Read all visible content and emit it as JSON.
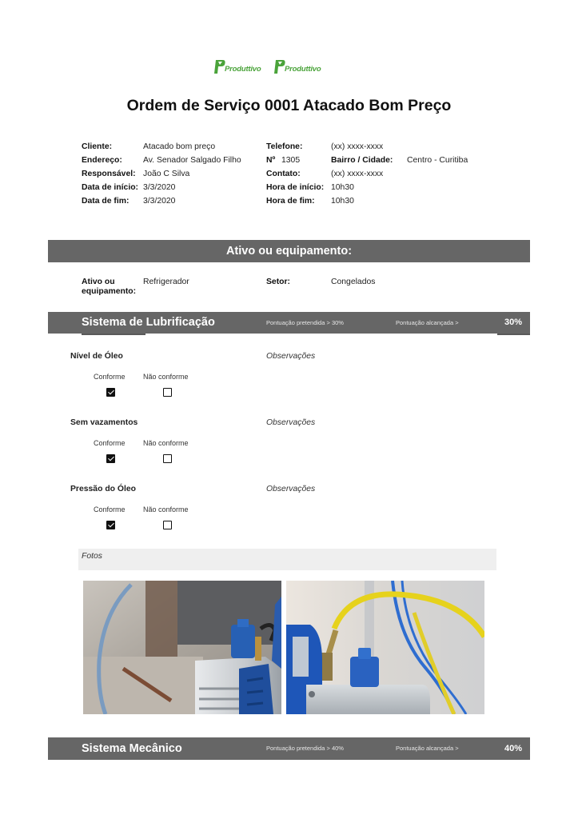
{
  "brand": {
    "logo_text": "Produttivo",
    "logo_color": "#4aa33a",
    "logo_count": 2
  },
  "document": {
    "title": "Ordem de Serviço 0001 Atacado Bom Preço"
  },
  "client_info": {
    "left": [
      {
        "label": "Cliente:",
        "value": "Atacado bom preço"
      },
      {
        "label": "Endereço:",
        "value": "Av. Senador Salgado Filho"
      },
      {
        "label": "Responsável:",
        "value": "João C Silva"
      },
      {
        "label": "Data de início:",
        "value": "3/3/2020"
      },
      {
        "label": "Data de fim:",
        "value": "3/3/2020"
      }
    ],
    "right": [
      {
        "label": "Telefone:",
        "value": "(xx) xxxx-xxxx"
      },
      {
        "label": "Nº",
        "value": "1305",
        "extra_label": "Bairro / Cidade:",
        "extra_value": "Centro - Curitiba"
      },
      {
        "label": "Contato:",
        "value": "(xx) xxxx-xxxx"
      },
      {
        "label": "Hora de início:",
        "value": "10h30"
      },
      {
        "label": "Hora de fim:",
        "value": "10h30"
      }
    ]
  },
  "asset_section": {
    "header": "Ativo ou equipamento:",
    "asset_label": "Ativo ou equipamento:",
    "asset_value": "Refrigerador",
    "sector_label": "Setor:",
    "sector_value": "Congelados"
  },
  "systems": [
    {
      "title": "Sistema de Lubrificação",
      "target_label": "Pontuação pretendida  > 30%",
      "achieved_label": "Pontuação alcançada >",
      "achieved_value": "30%",
      "items": [
        {
          "name": "Nível de Óleo",
          "observations_label": "Observações",
          "option_ok": "Conforme",
          "option_nok": "Não conforme",
          "conforme": true
        },
        {
          "name": "Sem vazamentos",
          "observations_label": "Observações",
          "option_ok": "Conforme",
          "option_nok": "Não conforme",
          "conforme": true
        },
        {
          "name": "Pressão do Óleo",
          "observations_label": "Observações",
          "option_ok": "Conforme",
          "option_nok": "Não conforme",
          "conforme": true
        }
      ],
      "photos_label": "Fotos",
      "photos": [
        {
          "description": "Vacuum pump with blue fittings on workbench"
        },
        {
          "description": "Vacuum pump with yellow and blue refrigerant hoses"
        }
      ]
    },
    {
      "title": "Sistema Mecânico",
      "target_label": "Pontuação pretendida > 40%",
      "achieved_label": "Pontuação alcançada >",
      "achieved_value": "40%"
    }
  ],
  "colors": {
    "section_bar": "#666666",
    "fotos_bg": "#efefef"
  }
}
